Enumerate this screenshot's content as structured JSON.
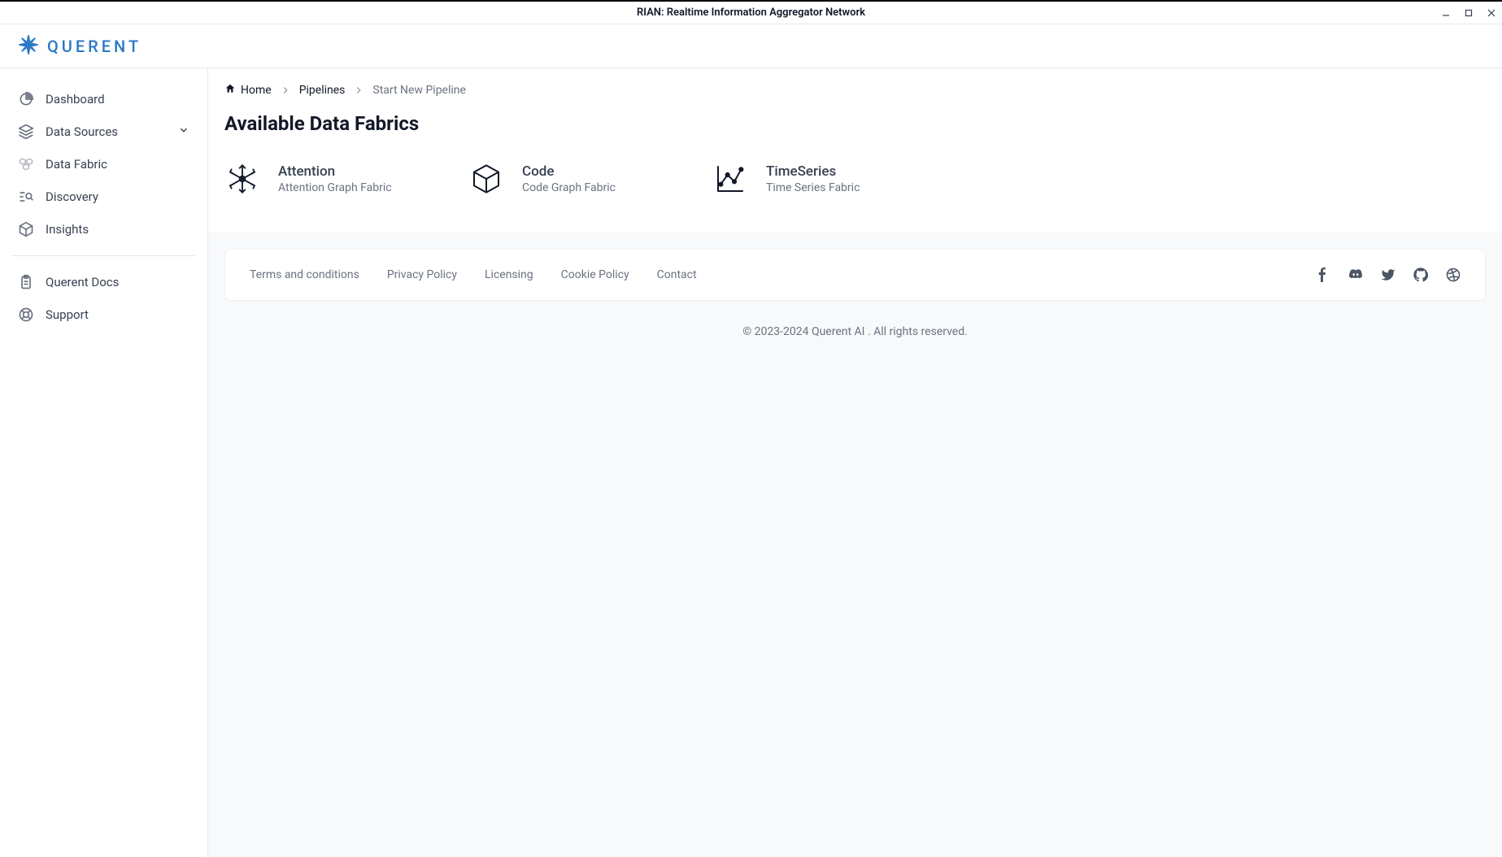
{
  "window": {
    "title": "RIAN: Realtime Information Aggregator Network"
  },
  "brand": {
    "name": "QUERENT"
  },
  "sidebar": {
    "items": [
      {
        "label": "Dashboard"
      },
      {
        "label": "Data Sources"
      },
      {
        "label": "Data Fabric"
      },
      {
        "label": "Discovery"
      },
      {
        "label": "Insights"
      }
    ],
    "secondary": [
      {
        "label": "Querent Docs"
      },
      {
        "label": "Support"
      }
    ]
  },
  "breadcrumb": {
    "items": [
      {
        "label": "Home"
      },
      {
        "label": "Pipelines"
      },
      {
        "label": "Start New Pipeline"
      }
    ]
  },
  "page": {
    "title": "Available Data Fabrics"
  },
  "fabrics": [
    {
      "title": "Attention",
      "subtitle": "Attention Graph Fabric"
    },
    {
      "title": "Code",
      "subtitle": "Code Graph Fabric"
    },
    {
      "title": "TimeSeries",
      "subtitle": "Time Series Fabric"
    }
  ],
  "footer": {
    "links": [
      "Terms and conditions",
      "Privacy Policy",
      "Licensing",
      "Cookie Policy",
      "Contact"
    ],
    "copyright": "© 2023-2024 Querent AI . All rights reserved."
  }
}
